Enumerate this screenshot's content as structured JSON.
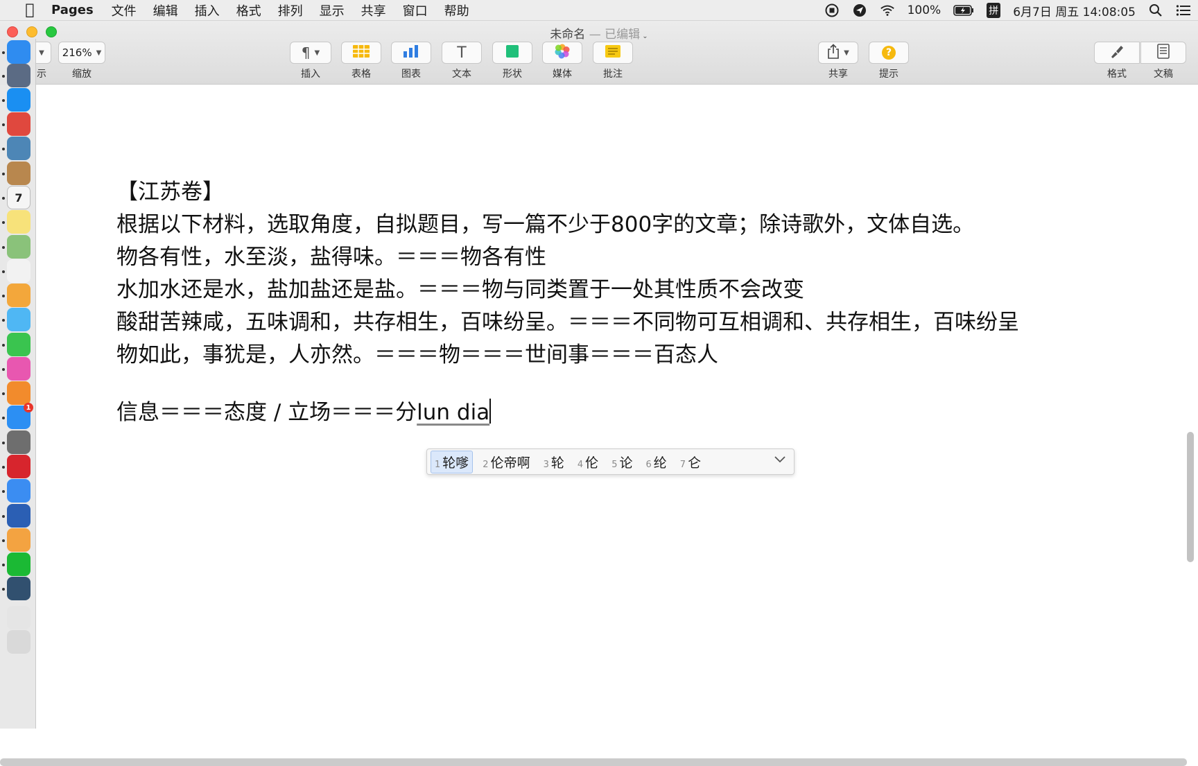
{
  "menubar": {
    "app_name": "Pages",
    "items": [
      "文件",
      "编辑",
      "插入",
      "格式",
      "排列",
      "显示",
      "共享",
      "窗口",
      "帮助"
    ],
    "battery": "100%",
    "ime_indicator": "拼",
    "datetime": "6月7日 周五  14:08:05"
  },
  "window": {
    "title": "未命名",
    "title_suffix": " — 已编辑"
  },
  "toolbar": {
    "partial_label": "示",
    "zoom_value": "216%",
    "zoom_label": "缩放",
    "insert_label": "插入",
    "table_label": "表格",
    "chart_label": "图表",
    "text_label": "文本",
    "text_glyph": "T",
    "shape_label": "形状",
    "media_label": "媒体",
    "comment_label": "批注",
    "share_label": "共享",
    "tips_label": "提示",
    "tips_glyph": "?",
    "format_label": "格式",
    "document_label": "文稿"
  },
  "document": {
    "lines": [
      "【江苏卷】",
      "根据以下材料，选取角度，自拟题目，写一篇不少于800字的文章；除诗歌外，文体自选。",
      "物各有性，水至淡，盐得味。＝＝＝物各有性",
      "水加水还是水，盐加盐还是盐。＝＝＝物与同类置于一处其性质不会改变",
      "酸甜苦辣咸，五味调和，共存相生，百味纷呈。＝＝＝不同物可互相调和、共存相生，百味纷呈",
      "物如此，事犹是，人亦然。＝＝＝物＝＝＝世间事＝＝＝百态人"
    ],
    "current_line_committed": "信息＝＝＝态度 / 立场＝＝＝分",
    "current_line_composing": "lun dia"
  },
  "ime": {
    "candidates": [
      {
        "num": "1",
        "text": "轮嗲"
      },
      {
        "num": "2",
        "text": "伦帝啊"
      },
      {
        "num": "3",
        "text": "轮"
      },
      {
        "num": "4",
        "text": "伦"
      },
      {
        "num": "5",
        "text": "论"
      },
      {
        "num": "6",
        "text": "纶"
      },
      {
        "num": "7",
        "text": "仑"
      }
    ],
    "selected_index": 0
  },
  "dock": {
    "calendar_day": "7",
    "appstore_badge": "1",
    "icons": [
      {
        "name": "finder-icon",
        "color": "#2f8cf0",
        "glyph": ""
      },
      {
        "name": "launchpad-icon",
        "color": "#5b6b84",
        "glyph": ""
      },
      {
        "name": "safari-icon",
        "color": "#1a8ff2",
        "glyph": ""
      },
      {
        "name": "chrome-icon",
        "color": "#e0483e",
        "glyph": ""
      },
      {
        "name": "preview-icon",
        "color": "#4d86b6",
        "glyph": ""
      },
      {
        "name": "contacts-icon",
        "color": "#b8874e",
        "glyph": ""
      },
      {
        "name": "calendar-icon",
        "color": "#f5f5f5",
        "glyph": ""
      },
      {
        "name": "notes-icon",
        "color": "#f7e27a",
        "glyph": ""
      },
      {
        "name": "maps-icon",
        "color": "#8ac27a",
        "glyph": ""
      },
      {
        "name": "reminders-icon",
        "color": "#f2f2f2",
        "glyph": ""
      },
      {
        "name": "photos-icon",
        "color": "#f3a73b",
        "glyph": ""
      },
      {
        "name": "messages-icon",
        "color": "#4fb7f4",
        "glyph": ""
      },
      {
        "name": "facetime-icon",
        "color": "#3ac44f",
        "glyph": ""
      },
      {
        "name": "itunes-icon",
        "color": "#e857b0",
        "glyph": ""
      },
      {
        "name": "books-icon",
        "color": "#f28b2c",
        "glyph": ""
      },
      {
        "name": "appstore-icon",
        "color": "#2c8ff3",
        "glyph": ""
      },
      {
        "name": "system-preferences-icon",
        "color": "#6e6e6e",
        "glyph": ""
      },
      {
        "name": "video-player-icon",
        "color": "#d7252d",
        "glyph": ""
      },
      {
        "name": "feishu-icon",
        "color": "#3b8df2",
        "glyph": ""
      },
      {
        "name": "word-icon",
        "color": "#2b5fb4",
        "glyph": ""
      },
      {
        "name": "pages-icon",
        "color": "#f3a341",
        "glyph": ""
      },
      {
        "name": "iqiyi-icon",
        "color": "#1bb934",
        "glyph": ""
      },
      {
        "name": "quicktime-icon",
        "color": "#31506f",
        "glyph": ""
      },
      {
        "name": "downloads-icon",
        "color": "#e5e5e5",
        "glyph": ""
      },
      {
        "name": "trash-icon",
        "color": "#d9d9d9",
        "glyph": ""
      }
    ]
  }
}
